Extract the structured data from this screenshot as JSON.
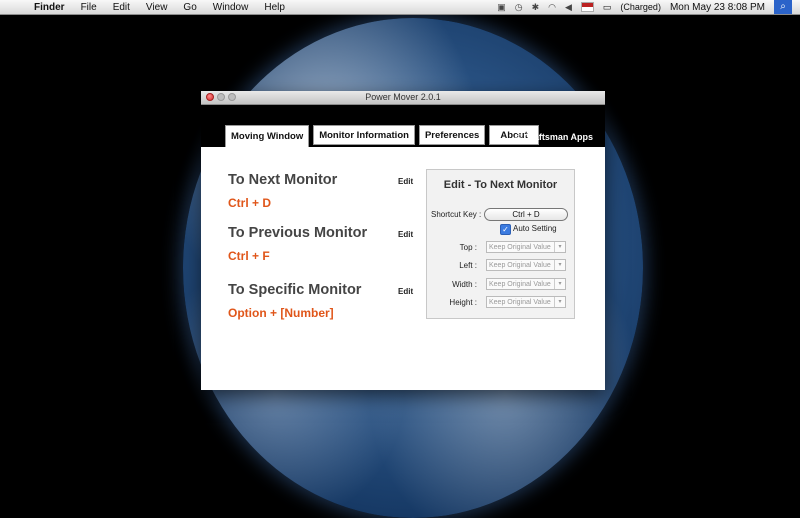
{
  "menubar": {
    "app": "Finder",
    "items": [
      "File",
      "Edit",
      "View",
      "Go",
      "Window",
      "Help"
    ],
    "battery": "(Charged)",
    "datetime": "Mon May 23  8:08 PM"
  },
  "window": {
    "title": "Power Mover 2.0.1",
    "tabs": [
      "Moving Window",
      "Monitor Information",
      "Preferences",
      "About"
    ],
    "copyright": "© Craftsman Apps"
  },
  "commands": [
    {
      "title": "To Next Monitor",
      "key": "Ctrl + D",
      "edit": "Edit"
    },
    {
      "title": "To Previous Monitor",
      "key": "Ctrl + F",
      "edit": "Edit"
    },
    {
      "title": "To Specific Monitor",
      "key": "Option + [Number]",
      "edit": "Edit"
    }
  ],
  "edit_panel": {
    "title": "Edit - To Next Monitor",
    "shortcut_label": "Shortcut Key :",
    "shortcut_value": "Ctrl + D",
    "auto_setting": "Auto Setting",
    "fields": [
      {
        "label": "Top :",
        "value": "Keep Original Value"
      },
      {
        "label": "Left :",
        "value": "Keep Original Value"
      },
      {
        "label": "Width :",
        "value": "Keep Original Value"
      },
      {
        "label": "Height :",
        "value": "Keep Original Value"
      }
    ]
  }
}
